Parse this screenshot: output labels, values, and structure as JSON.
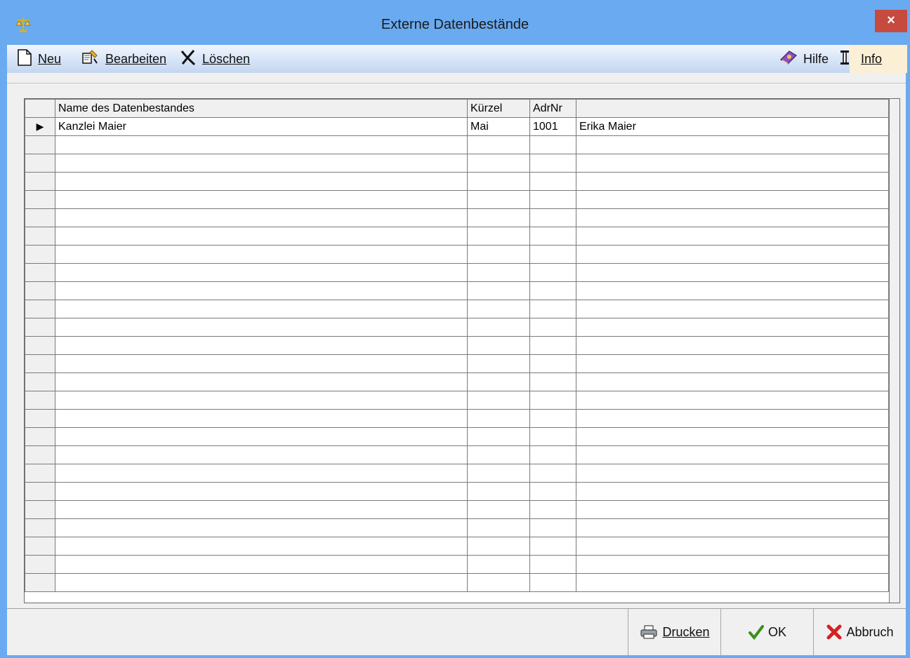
{
  "window": {
    "title": "Externe Datenbestände",
    "close_label": "×"
  },
  "toolbar": {
    "neu_label": "Neu",
    "bearbeiten_label": "Bearbeiten",
    "loeschen_label": "Löschen",
    "hilfe_label": "Hilfe",
    "info_label": "Info"
  },
  "grid": {
    "columns": [
      "Name des Datenbestandes",
      "Kürzel",
      "AdrNr",
      ""
    ],
    "rows": [
      {
        "name": "Kanzlei Maier",
        "kuerzel": "Mai",
        "adrnr": "1001",
        "person": "Erika Maier"
      }
    ],
    "current_row_marker": "▶"
  },
  "footer": {
    "drucken_label": "Drucken",
    "ok_label": "OK",
    "abbruch_label": "Abbruch"
  },
  "colors": {
    "titlebar": "#6aaaf0",
    "close": "#c74a3f",
    "info_highlight": "#fbefd5",
    "ok_check": "#3a8f1a",
    "abbruch_x": "#d42222"
  }
}
